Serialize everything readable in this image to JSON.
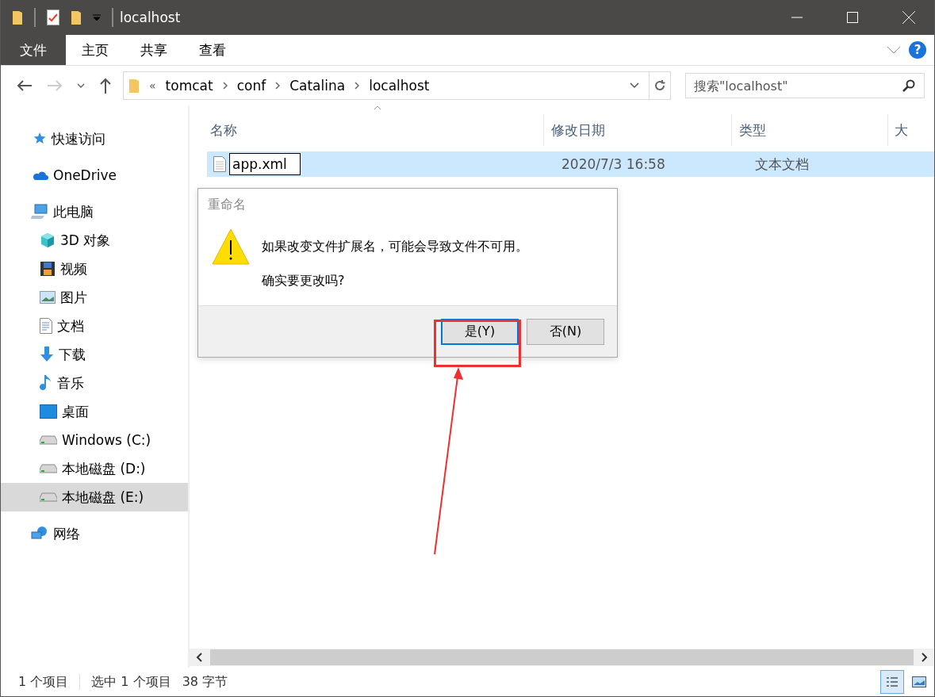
{
  "window": {
    "title": "localhost"
  },
  "ribbon": {
    "help": "?",
    "tabs": [
      {
        "label": "文件",
        "kind": "file",
        "selected": false
      },
      {
        "label": "主页",
        "kind": "tab",
        "selected": false
      },
      {
        "label": "共享",
        "kind": "tab",
        "selected": false
      },
      {
        "label": "查看",
        "kind": "tab",
        "selected": false
      }
    ]
  },
  "address_bar": {
    "overflow": "«",
    "path": [
      "tomcat",
      "conf",
      "Catalina",
      "localhost"
    ]
  },
  "search": {
    "placeholder": "搜索\"localhost\""
  },
  "sidebar": {
    "items": [
      {
        "label": "快速访问",
        "kind": "star",
        "selected": false
      },
      {
        "label": "OneDrive",
        "kind": "cloud",
        "selected": false
      },
      {
        "label": "此电脑",
        "kind": "pc",
        "selected": false,
        "children": [
          {
            "label": "3D 对象",
            "kind": "cube",
            "selected": false
          },
          {
            "label": "视频",
            "kind": "film",
            "selected": false
          },
          {
            "label": "图片",
            "kind": "picture",
            "selected": false
          },
          {
            "label": "文档",
            "kind": "doc",
            "selected": false
          },
          {
            "label": "下载",
            "kind": "down",
            "selected": false
          },
          {
            "label": "音乐",
            "kind": "note",
            "selected": false
          },
          {
            "label": "桌面",
            "kind": "desktop",
            "selected": false
          },
          {
            "label": "Windows (C:)",
            "kind": "drive",
            "selected": false
          },
          {
            "label": "本地磁盘 (D:)",
            "kind": "drive",
            "selected": false
          },
          {
            "label": "本地磁盘 (E:)",
            "kind": "drive",
            "selected": true
          }
        ]
      },
      {
        "label": "网络",
        "kind": "network",
        "selected": false
      }
    ]
  },
  "file_list": {
    "columns": [
      "名称",
      "修改日期",
      "类型",
      "大"
    ],
    "rows": [
      {
        "name": "app.xml",
        "editing": true,
        "date": "2020/7/3 16:58",
        "type": "文本文档",
        "selected": true
      }
    ]
  },
  "dialog": {
    "title": "重命名",
    "message": "如果改变文件扩展名，可能会导致文件不可用。",
    "question": "确实要更改吗?",
    "buttons": [
      {
        "label": "是(Y)",
        "default": true
      },
      {
        "label": "否(N)",
        "default": false
      }
    ]
  },
  "status_bar": {
    "items": [
      "1 个项目",
      "选中 1 个项目",
      "38 字节"
    ],
    "views": [
      {
        "kind": "details",
        "selected": true
      },
      {
        "kind": "large",
        "selected": false
      }
    ]
  }
}
